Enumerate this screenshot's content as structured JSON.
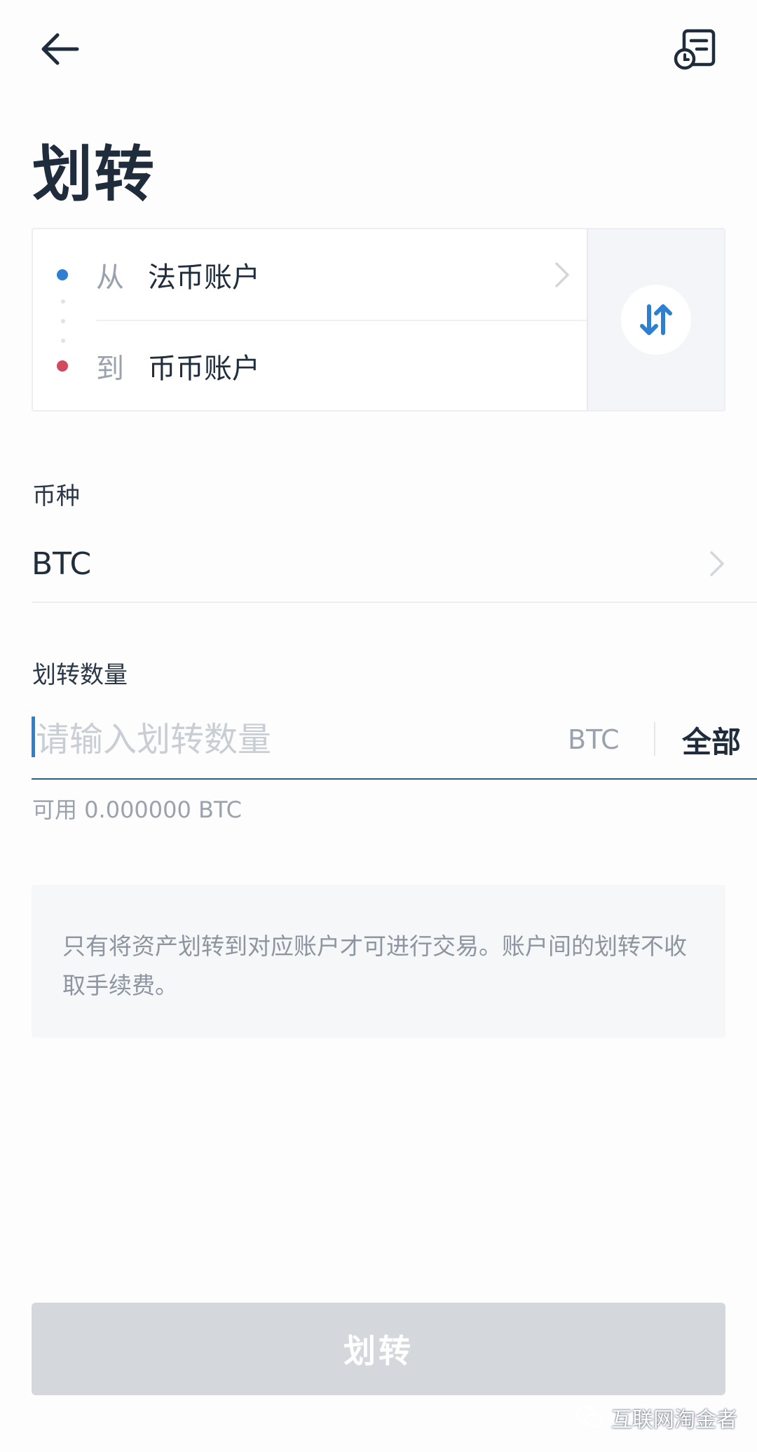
{
  "header": {
    "title": "划转"
  },
  "transfer": {
    "from_prefix": "从",
    "from_account": "法币账户",
    "to_prefix": "到",
    "to_account": "币币账户"
  },
  "currency": {
    "label": "币种",
    "value": "BTC"
  },
  "amount": {
    "label": "划转数量",
    "placeholder": "请输入划转数量",
    "unit": "BTC",
    "all_label": "全部",
    "available_text": "可用 0.000000 BTC"
  },
  "notice": {
    "text": "只有将资产划转到对应账户才可进行交易。账户间的划转不收取手续费。"
  },
  "submit": {
    "label": "划转"
  },
  "watermark": {
    "text": "互联网淘金者"
  },
  "colors": {
    "accent_blue": "#2e7fd1",
    "accent_red": "#d14a5e",
    "title": "#1e2c3c",
    "button_disabled": "#d4d8dd"
  },
  "icons": {
    "back": "arrow-left-icon",
    "history": "order-history-icon",
    "swap": "swap-arrows-icon",
    "chevron": "chevron-right-icon"
  }
}
